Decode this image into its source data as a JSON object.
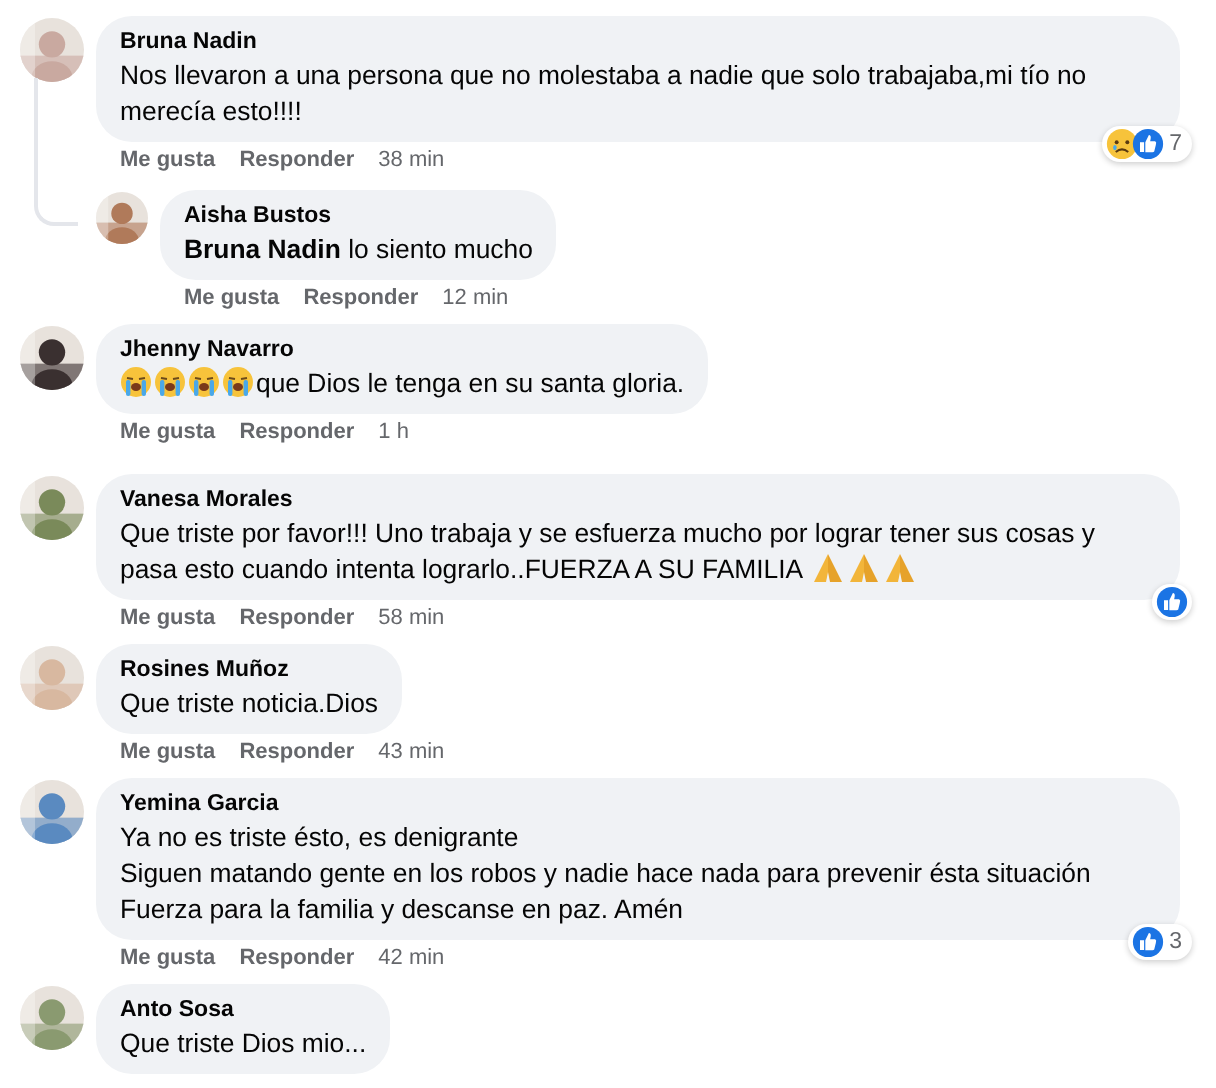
{
  "comments": [
    {
      "author": "Bruna Nadin",
      "lines": [
        {
          "text": "Nos llevaron a una persona que no molestaba a nadie que solo trabajaba,mi tío no"
        },
        {
          "text": "merecía esto!!!!"
        }
      ],
      "actions": {
        "like": "Me gusta",
        "reply": "Responder",
        "time": "38 min"
      },
      "reactions": {
        "icons": [
          {
            "kind": "sad"
          },
          {
            "kind": "like"
          }
        ],
        "count": "7"
      },
      "replies": [
        {
          "author": "Aisha Bustos",
          "lines": [
            {
              "text": "**Bruna Nadin** lo siento mucho"
            }
          ],
          "actions": {
            "like": "Me gusta",
            "reply": "Responder",
            "time": "12 min"
          }
        }
      ]
    },
    {
      "author": "Jhenny Navarro",
      "lines": [
        {
          "lead_icons": [
            {
              "kind": "crying"
            },
            {
              "kind": "crying"
            },
            {
              "kind": "crying"
            },
            {
              "kind": "crying"
            }
          ],
          "text": "que Dios le tenga en su santa gloria."
        }
      ],
      "actions": {
        "like": "Me gusta",
        "reply": "Responder",
        "time": "1 h"
      }
    },
    {
      "author": "Vanesa Morales",
      "lines": [
        {
          "text": "Que triste por favor!!! Uno trabaja y se esfuerza mucho por lograr tener sus cosas y"
        },
        {
          "text": "pasa esto cuando intenta lograrlo..FUERZA A SU FAMILIA",
          "trail_icons": [
            {
              "kind": "praying"
            },
            {
              "kind": "praying"
            },
            {
              "kind": "praying"
            }
          ]
        }
      ],
      "actions": {
        "like": "Me gusta",
        "reply": "Responder",
        "time": "58 min"
      },
      "reactions": {
        "icons": [
          {
            "kind": "like"
          }
        ]
      }
    },
    {
      "author": "Rosines Muñoz",
      "lines": [
        {
          "text": "Que triste noticia.Dios"
        }
      ],
      "actions": {
        "like": "Me gusta",
        "reply": "Responder",
        "time": "43 min"
      }
    },
    {
      "author": "Yemina Garcia",
      "lines": [
        {
          "text": "Ya no es triste ésto, es denigrante"
        },
        {
          "text": "Siguen matando gente en los robos y nadie hace nada para prevenir ésta situación"
        },
        {
          "text": "Fuerza para la familia y descanse en paz. Amén"
        }
      ],
      "actions": {
        "like": "Me gusta",
        "reply": "Responder",
        "time": "42 min"
      },
      "reactions": {
        "icons": [
          {
            "kind": "like"
          }
        ],
        "count": "3"
      }
    },
    {
      "author": "Anto Sosa",
      "lines": [
        {
          "text": "Que triste Dios mio..."
        }
      ]
    }
  ]
}
